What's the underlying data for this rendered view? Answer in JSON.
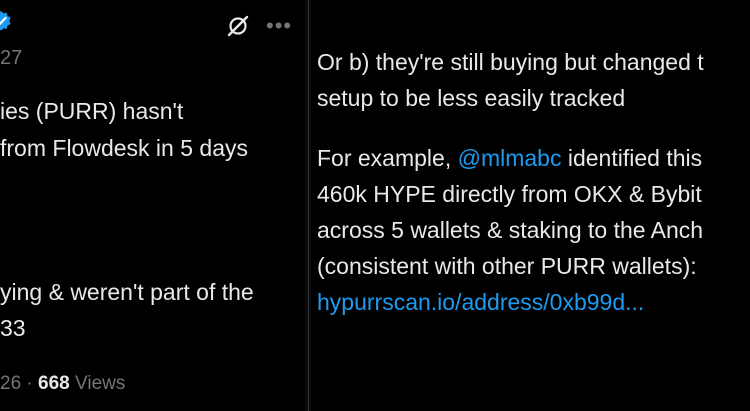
{
  "colors": {
    "background": "#000000",
    "text": "#e7e9ea",
    "muted": "#71767b",
    "link": "#1d9bf0"
  },
  "left_tweet": {
    "handle_date_fragment": "27",
    "lines": [
      "ies (PURR) hasn't",
      "from Flowdesk in 5 days",
      "ying & weren't part of the",
      "33"
    ],
    "meta": {
      "time_fragment": "26",
      "separator": "·",
      "views_count": "668",
      "views_label": "Views"
    },
    "icons": [
      "verified-badge-icon",
      "grok-icon",
      "more-icon"
    ]
  },
  "right_tweet": {
    "line_1": "Or b) they're still buying but changed t",
    "line_2": "setup to be less easily tracked",
    "line_3_before": "For example, ",
    "mention": "@mlmabc",
    "line_3_after": " identified this",
    "line_4": "460k HYPE directly from OKX & Bybit",
    "line_5": "across 5 wallets & staking to the Anch",
    "line_6": "(consistent with other PURR wallets):",
    "link_url": "hypurrscan.io/address/0xb99d..."
  }
}
